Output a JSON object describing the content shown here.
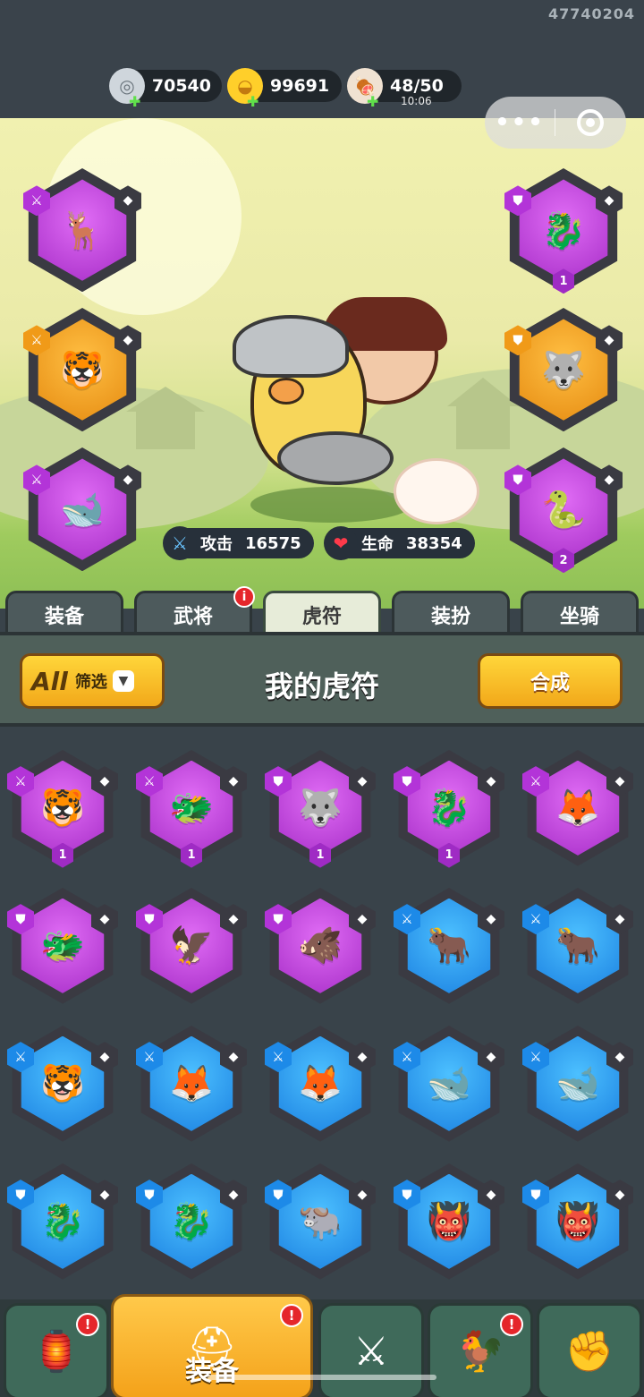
{
  "uid": "47740204",
  "resources": {
    "silver": {
      "value": "70540",
      "icon": "silver-coin-icon"
    },
    "gold": {
      "value": "99691",
      "icon": "gold-ingot-icon"
    },
    "stamina": {
      "value": "48/50",
      "timer": "10:06",
      "icon": "meat-icon"
    }
  },
  "capsule": {
    "more_icon": "more-dots-icon",
    "close_icon": "target-close-icon"
  },
  "stats": {
    "attack_label": "攻击",
    "attack_value": "16575",
    "hp_label": "生命",
    "hp_value": "38354"
  },
  "equipped": [
    {
      "rarity": "purple",
      "glyph": "🦌",
      "tag": "sword",
      "level": ""
    },
    {
      "rarity": "purple",
      "glyph": "🐉",
      "tag": "shield",
      "level": "1"
    },
    {
      "rarity": "orange",
      "glyph": "🐯",
      "tag": "sword",
      "level": ""
    },
    {
      "rarity": "orange",
      "glyph": "🐺",
      "tag": "shield",
      "level": ""
    },
    {
      "rarity": "purple",
      "glyph": "🐋",
      "tag": "sword",
      "level": ""
    },
    {
      "rarity": "purple",
      "glyph": "🐍",
      "tag": "shield",
      "level": "2"
    }
  ],
  "tabs": [
    {
      "label": "装备",
      "active": false,
      "badge": ""
    },
    {
      "label": "武将",
      "active": false,
      "badge": "i"
    },
    {
      "label": "虎符",
      "active": true,
      "badge": ""
    },
    {
      "label": "装扮",
      "active": false,
      "badge": ""
    },
    {
      "label": "坐骑",
      "active": false,
      "badge": ""
    }
  ],
  "panel": {
    "filter_all": "All",
    "filter_label": "筛选",
    "title": "我的虎符",
    "merge_label": "合成"
  },
  "grid": [
    {
      "rarity": "purple",
      "glyph": "🐯",
      "tag": "sword",
      "level": "1"
    },
    {
      "rarity": "purple",
      "glyph": "🐲",
      "tag": "sword",
      "level": "1"
    },
    {
      "rarity": "purple",
      "glyph": "🐺",
      "tag": "shield",
      "level": "1"
    },
    {
      "rarity": "purple",
      "glyph": "🐉",
      "tag": "shield",
      "level": "1"
    },
    {
      "rarity": "purple",
      "glyph": "🦊",
      "tag": "sword",
      "level": ""
    },
    {
      "rarity": "purple",
      "glyph": "🐲",
      "tag": "shield",
      "level": ""
    },
    {
      "rarity": "purple",
      "glyph": "🦅",
      "tag": "shield",
      "level": ""
    },
    {
      "rarity": "purple",
      "glyph": "🐗",
      "tag": "shield",
      "level": ""
    },
    {
      "rarity": "blue",
      "glyph": "🐂",
      "tag": "sword",
      "level": ""
    },
    {
      "rarity": "blue",
      "glyph": "🐂",
      "tag": "sword",
      "level": ""
    },
    {
      "rarity": "blue",
      "glyph": "🐯",
      "tag": "sword",
      "level": ""
    },
    {
      "rarity": "blue",
      "glyph": "🦊",
      "tag": "sword",
      "level": ""
    },
    {
      "rarity": "blue",
      "glyph": "🦊",
      "tag": "sword",
      "level": ""
    },
    {
      "rarity": "blue",
      "glyph": "🐋",
      "tag": "sword",
      "level": ""
    },
    {
      "rarity": "blue",
      "glyph": "🐋",
      "tag": "sword",
      "level": ""
    },
    {
      "rarity": "blue",
      "glyph": "🐉",
      "tag": "shield",
      "level": ""
    },
    {
      "rarity": "blue",
      "glyph": "🐉",
      "tag": "shield",
      "level": ""
    },
    {
      "rarity": "blue",
      "glyph": "🐃",
      "tag": "shield",
      "level": ""
    },
    {
      "rarity": "blue",
      "glyph": "👹",
      "tag": "shield",
      "level": ""
    },
    {
      "rarity": "blue",
      "glyph": "👹",
      "tag": "shield",
      "level": ""
    }
  ],
  "bottom_nav": [
    {
      "name": "shop",
      "icon": "🏮",
      "label": "",
      "active": false,
      "badge": "!"
    },
    {
      "name": "equipment",
      "icon": "⛑",
      "label": "装备",
      "active": true,
      "badge": "!"
    },
    {
      "name": "battle",
      "icon": "⚔",
      "label": "",
      "active": false,
      "badge": ""
    },
    {
      "name": "heroes",
      "icon": "🐓",
      "label": "",
      "active": false,
      "badge": "!"
    },
    {
      "name": "upgrade",
      "icon": "✊",
      "label": "",
      "active": false,
      "badge": ""
    }
  ]
}
